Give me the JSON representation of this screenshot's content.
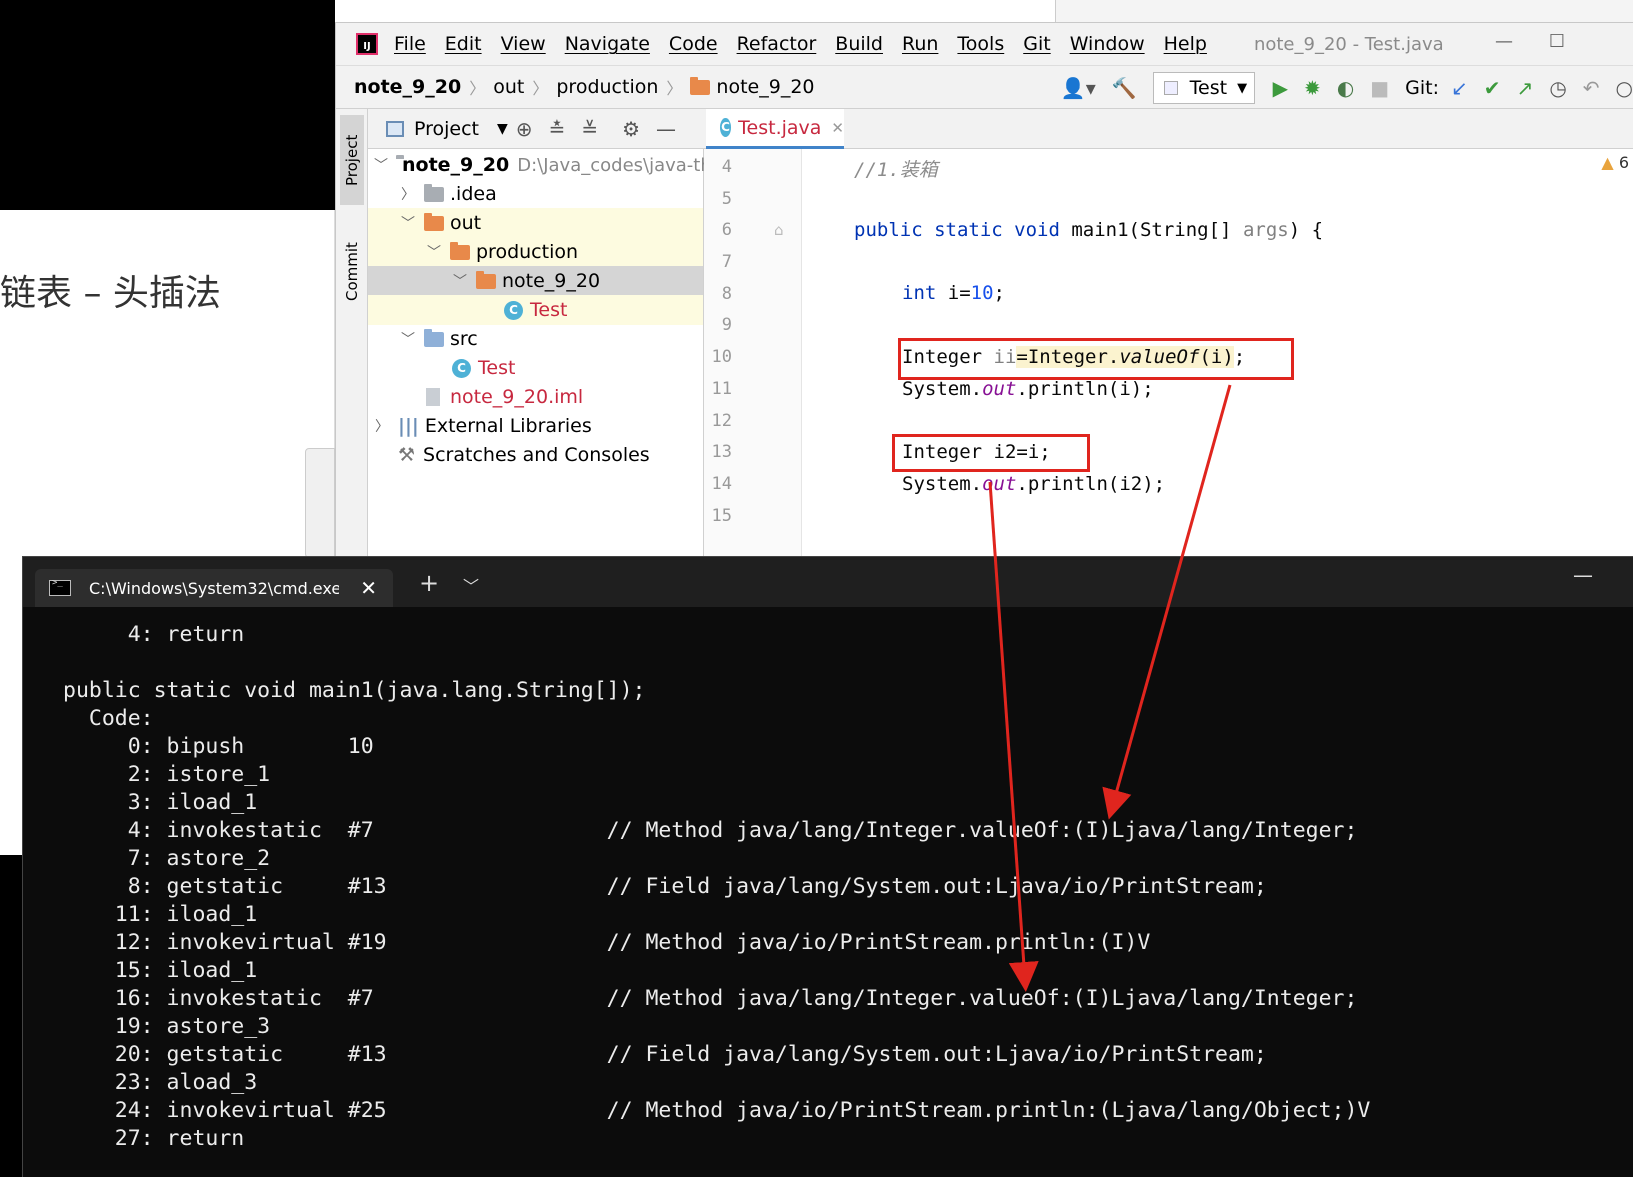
{
  "background": {
    "slide_text": "链表 – 头插法"
  },
  "ide": {
    "logo": "IJ",
    "menu": [
      "File",
      "Edit",
      "View",
      "Navigate",
      "Code",
      "Refactor",
      "Build",
      "Run",
      "Tools",
      "Git",
      "Window",
      "Help"
    ],
    "window_title": "note_9_20 - Test.java",
    "breadcrumbs": [
      "note_9_20",
      "out",
      "production",
      "note_9_20"
    ],
    "run_config": "Test",
    "git_label": "Git:",
    "side_tabs": {
      "project": "Project",
      "commit": "Commit"
    },
    "project_panel": {
      "title": "Project"
    },
    "tree": [
      {
        "label": "note_9_20",
        "path": "D:\\Java_codes\\java-th"
      },
      {
        "label": ".idea"
      },
      {
        "label": "out"
      },
      {
        "label": "production"
      },
      {
        "label": "note_9_20"
      },
      {
        "label": "Test"
      },
      {
        "label": "src"
      },
      {
        "label": "Test"
      },
      {
        "label": "note_9_20.iml"
      },
      {
        "label": "External Libraries"
      },
      {
        "label": "Scratches and Consoles"
      }
    ],
    "editor_tab": "Test.java",
    "warning_count": "6",
    "line_numbers": [
      "4",
      "5",
      "6",
      "7",
      "8",
      "9",
      "10",
      "11",
      "12",
      "13",
      "14",
      "15"
    ],
    "code": {
      "l4": "//1.装箱",
      "l6_kw": "public static void",
      "l6_name": " main1(String[] ",
      "l6_param": "args",
      "l6_end": ") {",
      "l8_kw": "int",
      "l8_mid": " i=",
      "l8_num": "10",
      "l8_end": ";",
      "l10_a": "Integer ",
      "l10_var": "ii",
      "l10_b": "=Integer.",
      "l10_fn": "valueOf",
      "l10_c": "(i)",
      "l10_d": ";",
      "l11_a": "System.",
      "l11_fld": "out",
      "l11_b": ".println(i);",
      "l13": "Integer i2=i;",
      "l14_a": "System.",
      "l14_fld": "out",
      "l14_b": ".println(i2);"
    }
  },
  "terminal": {
    "tab_title": "C:\\Windows\\System32\\cmd.exe",
    "lines": [
      "     4: return",
      "",
      "public static void main1(java.lang.String[]);",
      "  Code:",
      "     0: bipush        10",
      "     2: istore_1",
      "     3: iload_1",
      "     4: invokestatic  #7                  // Method java/lang/Integer.valueOf:(I)Ljava/lang/Integer;",
      "     7: astore_2",
      "     8: getstatic     #13                 // Field java/lang/System.out:Ljava/io/PrintStream;",
      "    11: iload_1",
      "    12: invokevirtual #19                 // Method java/io/PrintStream.println:(I)V",
      "    15: iload_1",
      "    16: invokestatic  #7                  // Method java/lang/Integer.valueOf:(I)Ljava/lang/Integer;",
      "    19: astore_3",
      "    20: getstatic     #13                 // Field java/lang/System.out:Ljava/io/PrintStream;",
      "    23: aload_3",
      "    24: invokevirtual #25                 // Method java/io/PrintStream.println:(Ljava/lang/Object;)V",
      "    27: return"
    ]
  },
  "colors": {
    "annotation_red": "#e0251e",
    "accent_blue": "#4083c9"
  }
}
